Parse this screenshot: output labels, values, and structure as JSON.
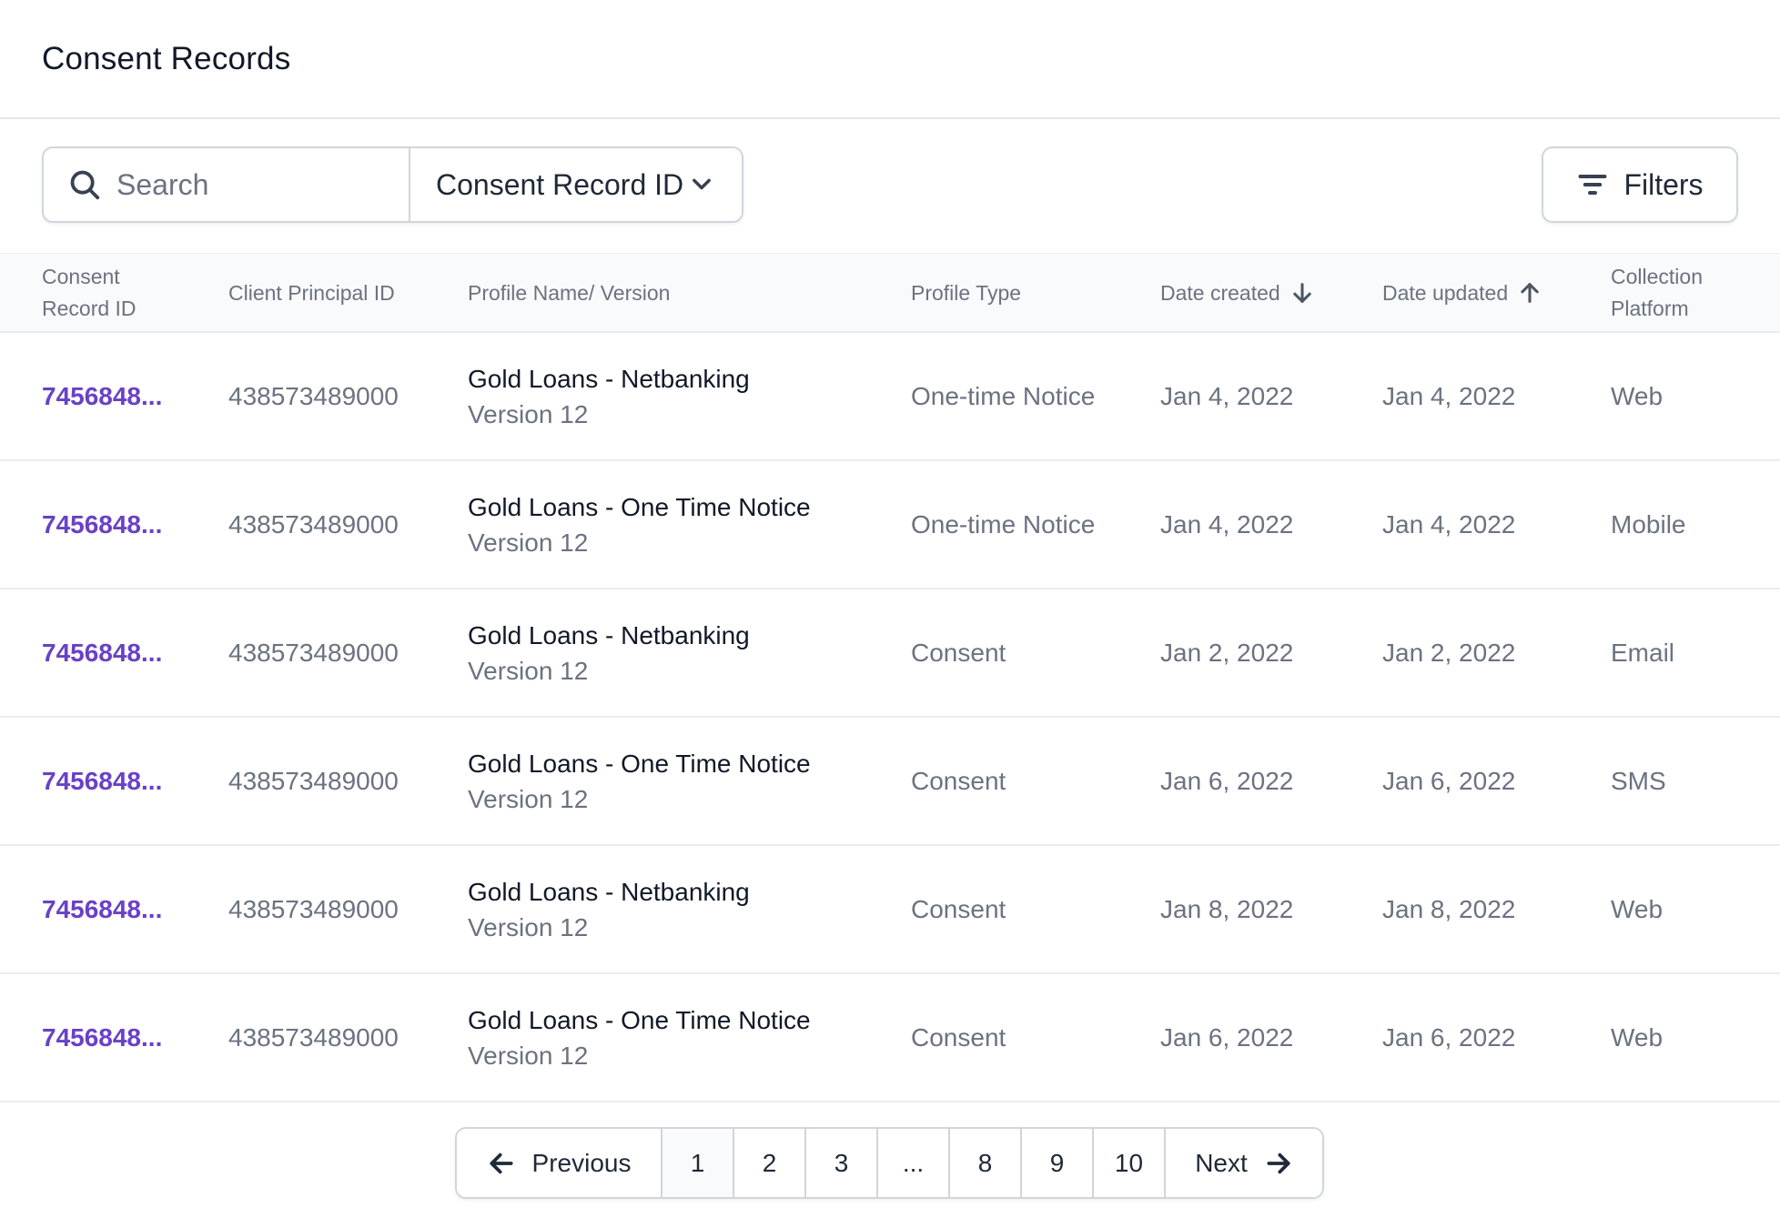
{
  "page": {
    "title": "Consent Records"
  },
  "toolbar": {
    "search_placeholder": "Search",
    "search_by_selected": "Consent Record ID",
    "filters_label": "Filters"
  },
  "table": {
    "columns": [
      {
        "label_line1": "Consent",
        "label_line2": "Record ID"
      },
      {
        "label": "Client Principal ID"
      },
      {
        "label": "Profile Name/ Version"
      },
      {
        "label": "Profile Type"
      },
      {
        "label": "Date created",
        "sort": "descending"
      },
      {
        "label": "Date updated",
        "sort": "ascending"
      },
      {
        "label_line1": "Collection",
        "label_line2": "Platform"
      }
    ],
    "rows": [
      {
        "consent_id": "7456848...",
        "client_principal_id": "438573489000",
        "profile_name": "Gold Loans - Netbanking",
        "profile_version": "Version 12",
        "profile_type": "One-time Notice",
        "date_created": "Jan 4, 2022",
        "date_updated": "Jan 4, 2022",
        "platform": "Web"
      },
      {
        "consent_id": "7456848...",
        "client_principal_id": "438573489000",
        "profile_name": "Gold Loans - One Time Notice",
        "profile_version": "Version 12",
        "profile_type": "One-time Notice",
        "date_created": "Jan 4, 2022",
        "date_updated": "Jan 4, 2022",
        "platform": "Mobile"
      },
      {
        "consent_id": "7456848...",
        "client_principal_id": "438573489000",
        "profile_name": "Gold Loans - Netbanking",
        "profile_version": "Version 12",
        "profile_type": "Consent",
        "date_created": "Jan 2, 2022",
        "date_updated": "Jan 2, 2022",
        "platform": "Email"
      },
      {
        "consent_id": "7456848...",
        "client_principal_id": "438573489000",
        "profile_name": "Gold Loans - One Time Notice",
        "profile_version": "Version 12",
        "profile_type": "Consent",
        "date_created": "Jan 6, 2022",
        "date_updated": "Jan 6, 2022",
        "platform": "SMS"
      },
      {
        "consent_id": "7456848...",
        "client_principal_id": "438573489000",
        "profile_name": "Gold Loans - Netbanking",
        "profile_version": "Version 12",
        "profile_type": "Consent",
        "date_created": "Jan 8, 2022",
        "date_updated": "Jan 8, 2022",
        "platform": "Web"
      },
      {
        "consent_id": "7456848...",
        "client_principal_id": "438573489000",
        "profile_name": "Gold Loans - One Time Notice",
        "profile_version": "Version 12",
        "profile_type": "Consent",
        "date_created": "Jan 6, 2022",
        "date_updated": "Jan 6, 2022",
        "platform": "Web"
      }
    ]
  },
  "pagination": {
    "previous_label": "Previous",
    "next_label": "Next",
    "pages": [
      "1",
      "2",
      "3",
      "...",
      "8",
      "9",
      "10"
    ],
    "current_page": "1"
  },
  "colors": {
    "accent": "#6941c6",
    "text_primary": "#111827",
    "text_secondary": "#6b7280",
    "border": "#d1d5db",
    "header_bg": "#f9fafb"
  },
  "icons": {
    "search": "search-icon",
    "dropdown": "chevron-down-icon",
    "filters": "filter-lines-icon",
    "sort_desc": "arrow-down-icon",
    "sort_asc": "arrow-up-icon",
    "prev": "arrow-left-icon",
    "next": "arrow-right-icon"
  }
}
